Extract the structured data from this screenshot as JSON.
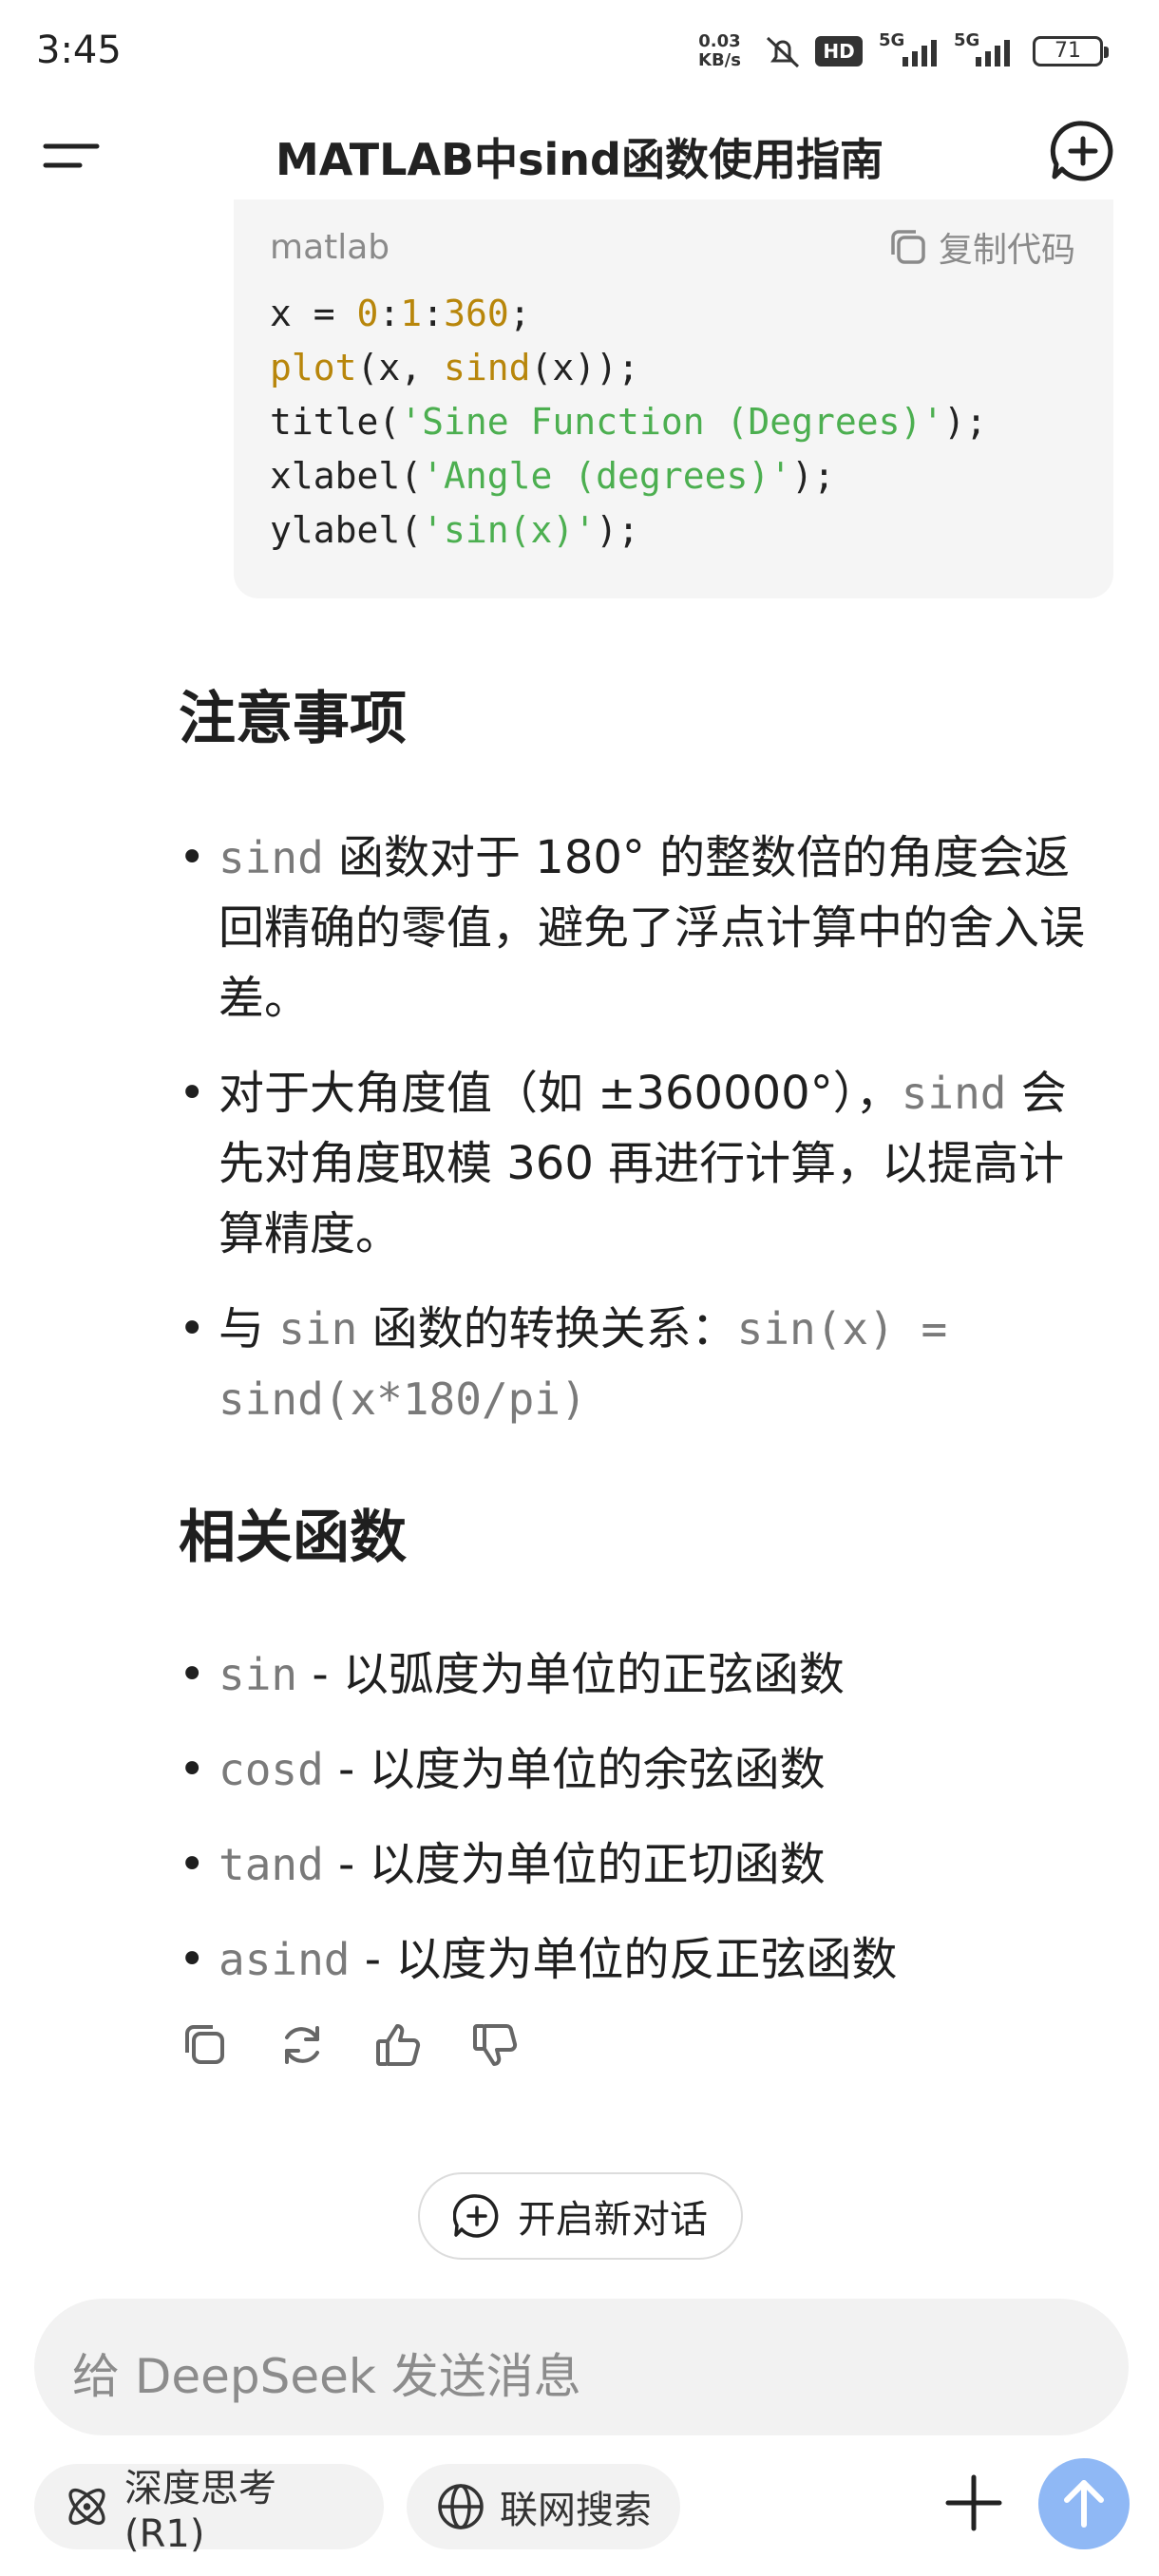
{
  "status_bar": {
    "time": "3:45",
    "net_speed": "0.03",
    "net_unit": "KB/s",
    "hd": "HD",
    "signal1": "5G",
    "signal2": "5G",
    "battery": "71"
  },
  "header": {
    "title": "MATLAB中sind函数使用指南"
  },
  "code_block": {
    "language": "matlab",
    "copy_label": "复制代码"
  },
  "sections": {
    "notes_heading": "注意事项",
    "notes": [
      {
        "code": "sind",
        "text": " 函数对于 180° 的整数倍的角度会返回精确的零值，避免了浮点计算中的舍入误差。"
      },
      {
        "pre": "对于大角度值（如 ±360000°），",
        "code": "sind",
        "post": " 会先对角度取模 360 再进行计算，以提高计算精度。"
      },
      {
        "pre": "与 ",
        "code": "sin",
        "mid": " 函数的转换关系：",
        "code2": "sin(x) = sind(x*180/pi)"
      }
    ],
    "related_heading": "相关函数",
    "related": [
      {
        "code": "sin",
        "text": " - 以弧度为单位的正弦函数"
      },
      {
        "code": "cosd",
        "text": " - 以度为单位的余弦函数"
      },
      {
        "code": "tand",
        "text": " - 以度为单位的正切函数"
      },
      {
        "code": "asind",
        "text": " - 以度为单位的反正弦函数"
      }
    ]
  },
  "new_dialog_label": "开启新对话",
  "input": {
    "placeholder": "给 DeepSeek 发送消息"
  },
  "chips": {
    "deep_think": "深度思考 (R1)",
    "web_search": "联网搜索"
  },
  "colors": {
    "accent_send": "#8fb8f5",
    "string_green": "#4caf50",
    "number_gold": "#b8860b"
  }
}
